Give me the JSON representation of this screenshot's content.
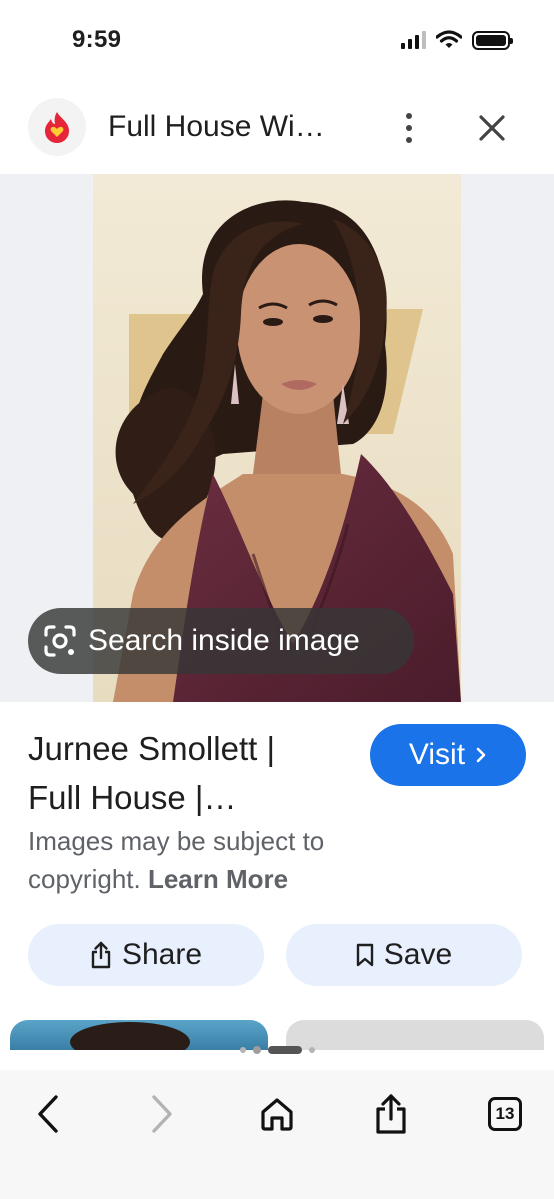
{
  "status_bar": {
    "time": "9:59"
  },
  "header": {
    "title": "Full House Wi…",
    "logo_icon": "fire-heart-icon",
    "more_icon": "more-vert-icon",
    "close_icon": "close-icon"
  },
  "image": {
    "search_inside_label": "Search inside image",
    "lens_icon": "google-lens-icon"
  },
  "result": {
    "title_line1": "Jurnee Smollett |",
    "title_line2": "Full House |…",
    "visit_label": "Visit",
    "copyright_text": "Images may be subject to copyright.",
    "learn_more_label": "Learn More"
  },
  "actions": {
    "share_label": "Share",
    "save_label": "Save"
  },
  "toolbar": {
    "tab_count": "13"
  },
  "colors": {
    "accent_blue": "#1a73e8",
    "pill_background": "#e8f0fe",
    "logo_red": "#e5253a",
    "logo_yellow": "#ffcc33"
  }
}
